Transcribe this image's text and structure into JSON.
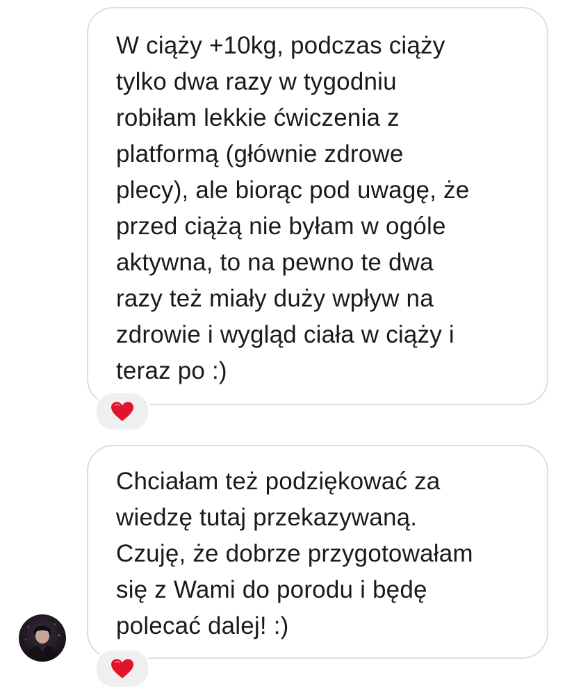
{
  "conversation": {
    "messages": [
      {
        "sender": "other",
        "lines": [
          "W ciąży +10kg, podczas ciąży",
          "tylko dwa razy w tygodniu",
          "robiłam lekkie ćwiczenia z",
          "platformą (głównie zdrowe",
          "plecy), ale biorąc pod uwagę, że",
          "przed ciążą nie byłam w ogóle",
          "aktywna, to na pewno te dwa",
          "razy też miały duży wpływ na",
          "zdrowie i wygląd ciała w ciąży i",
          "teraz po :)"
        ],
        "reaction": "red-heart"
      },
      {
        "sender": "other",
        "lines": [
          "Chciałam też podziękować za",
          "wiedzę tutaj przekazywaną.",
          "Czuję, że dobrze przygotowałam",
          "się z Wami do porodu i będę",
          "polecać dalej! :)"
        ],
        "reaction": "red-heart"
      }
    ]
  },
  "colors": {
    "bubble_border": "#dedede",
    "reaction_bg": "#efefef",
    "heart": "#e0142a",
    "text": "#1a1a1a"
  },
  "icons": {
    "reaction": "red-heart-icon",
    "avatar": "user-avatar"
  }
}
